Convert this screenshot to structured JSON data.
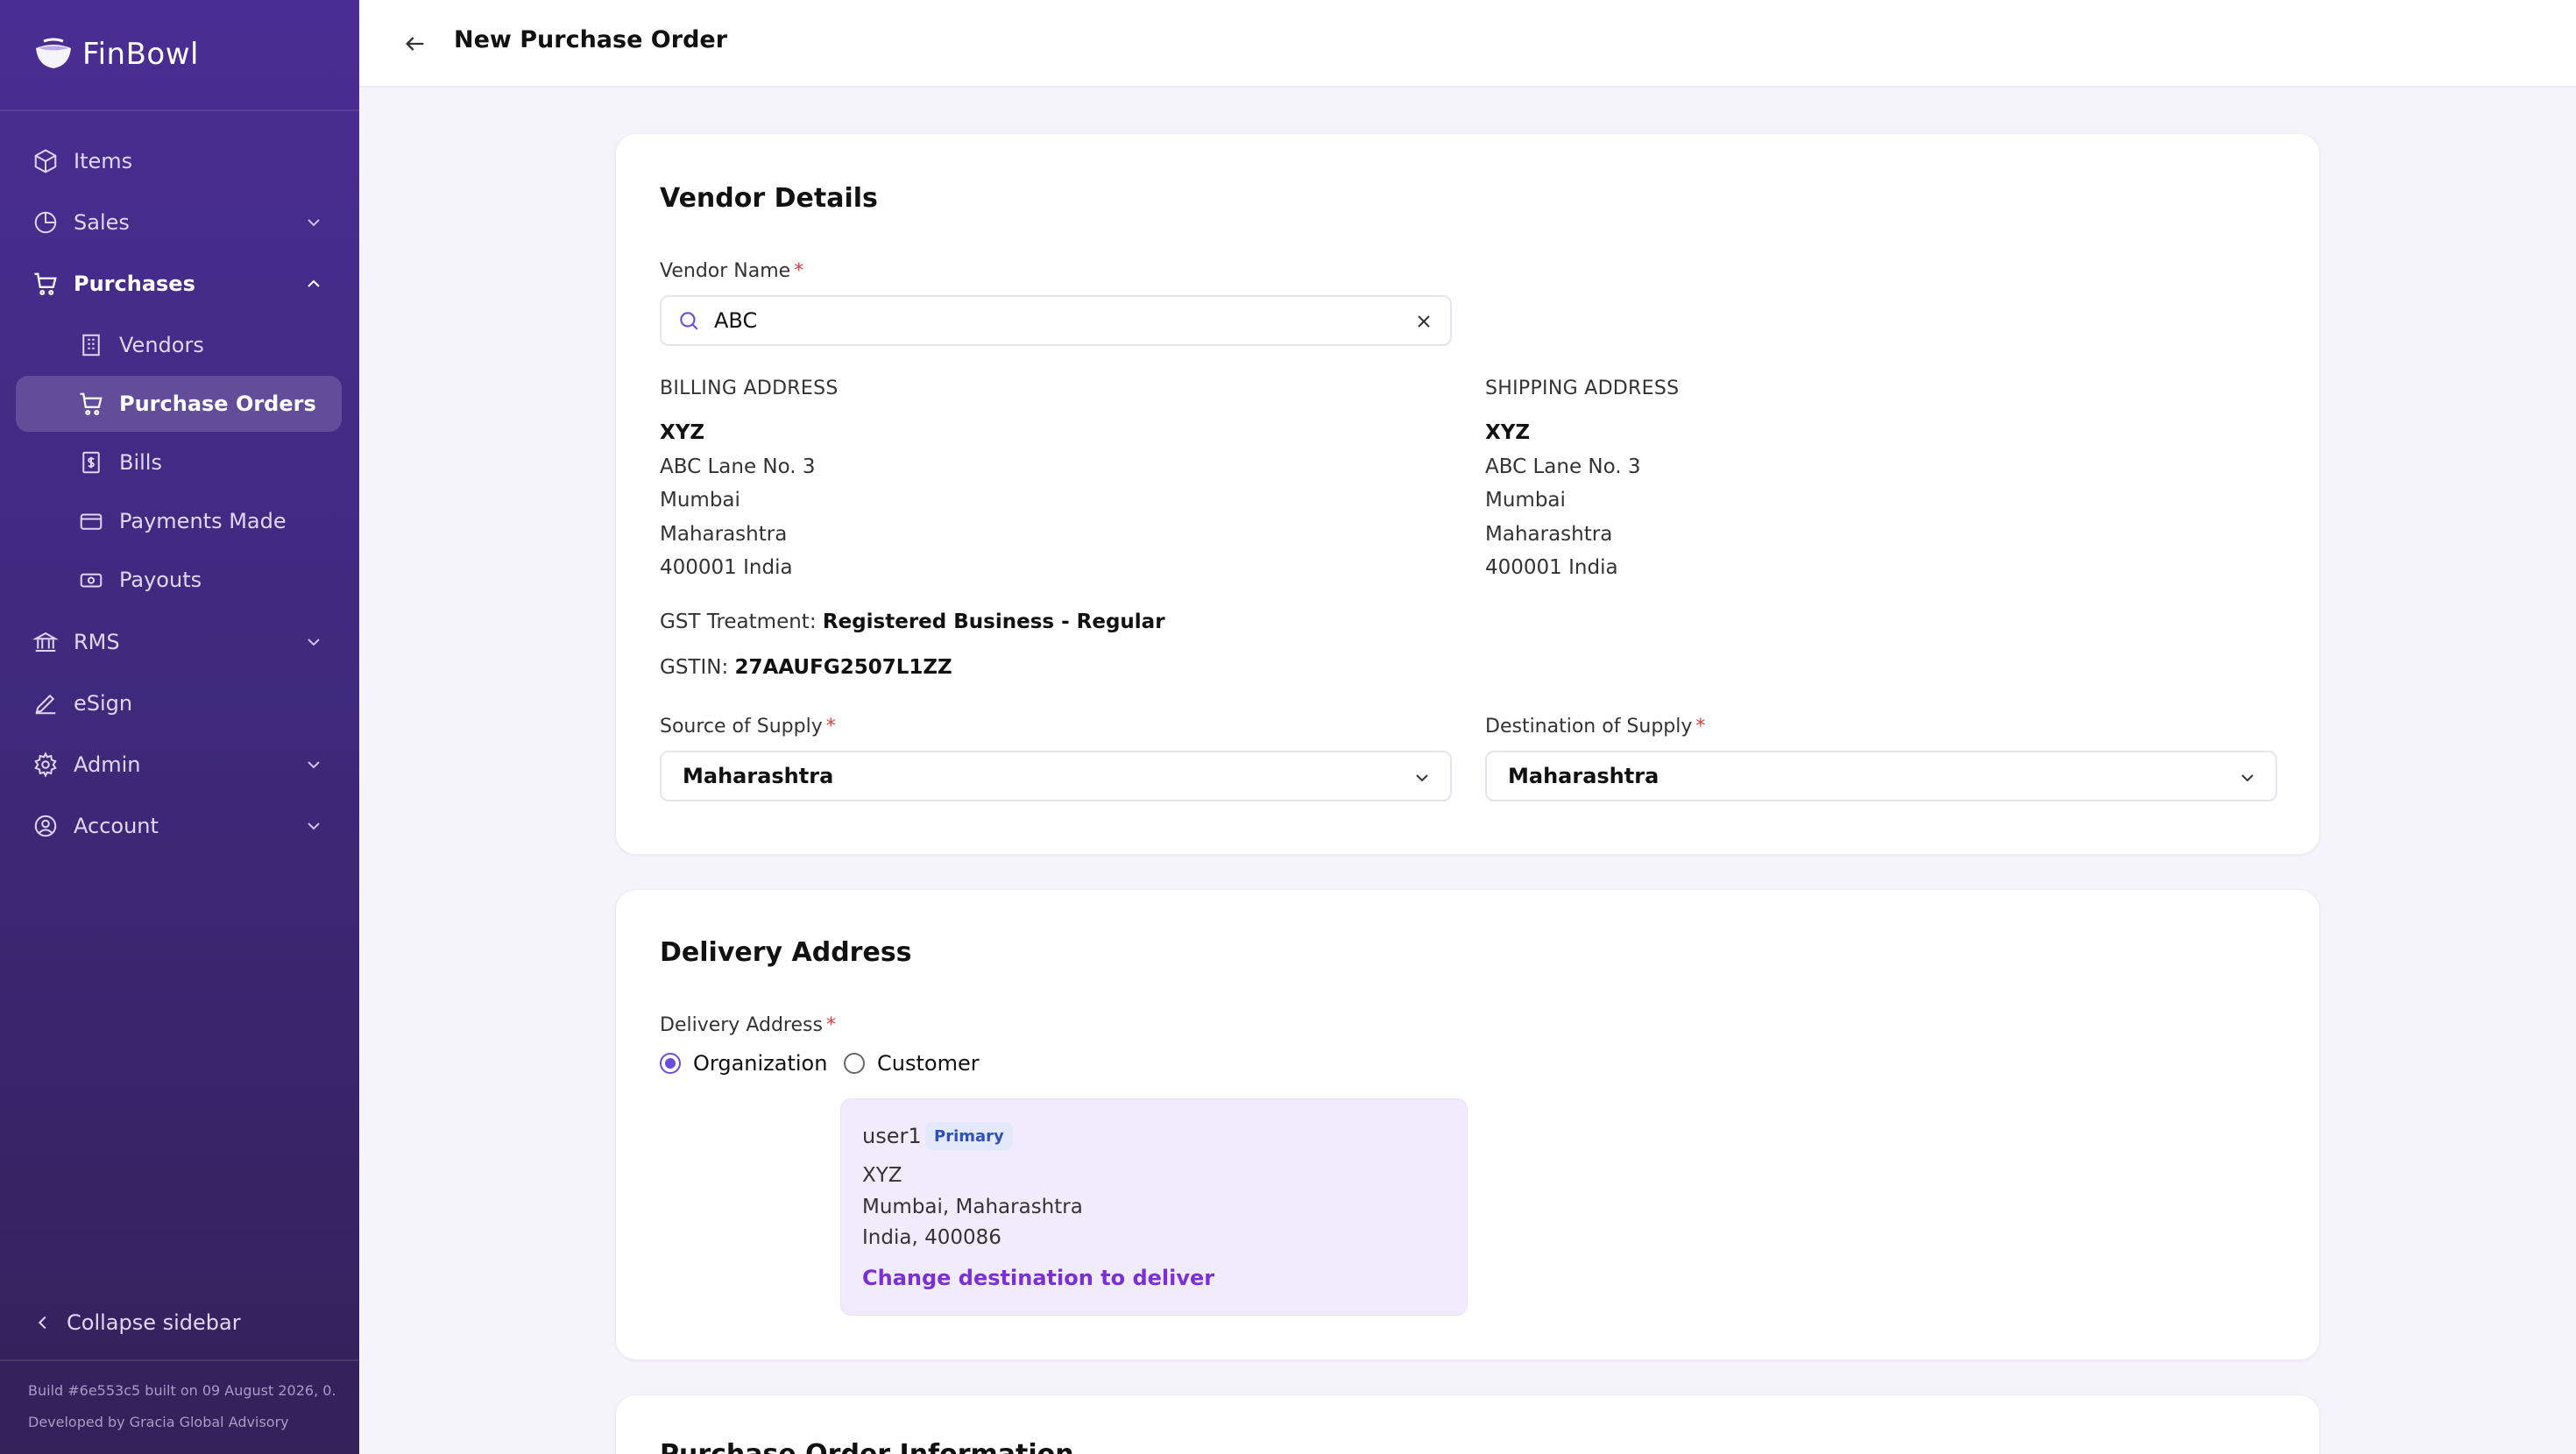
{
  "brand": {
    "name": "FinBowl"
  },
  "sidebar": {
    "items": [
      {
        "label": "Items",
        "icon": "cube-icon"
      },
      {
        "label": "Sales",
        "icon": "pie-chart-icon"
      },
      {
        "label": "Purchases",
        "icon": "cart-icon"
      },
      {
        "label": "Vendors",
        "icon": "building-icon"
      },
      {
        "label": "Purchase Orders",
        "icon": "cart-icon"
      },
      {
        "label": "Bills",
        "icon": "bill-icon"
      },
      {
        "label": "Payments Made",
        "icon": "card-icon"
      },
      {
        "label": "Payouts",
        "icon": "cash-icon"
      },
      {
        "label": "RMS",
        "icon": "bank-icon"
      },
      {
        "label": "eSign",
        "icon": "pen-icon"
      },
      {
        "label": "Admin",
        "icon": "gear-icon"
      },
      {
        "label": "Account",
        "icon": "user-circle-icon"
      }
    ],
    "collapse_label": "Collapse sidebar",
    "build_text": "Build #6e553c5 built on 09 August 2026, 0...",
    "developer_text": "Developed by Gracia Global Advisory"
  },
  "header": {
    "title": "New Purchase Order"
  },
  "vendor": {
    "title": "Vendor Details",
    "vendor_name_label": "Vendor Name",
    "required_mark": "*",
    "vendor_name_value": "ABC",
    "billing": {
      "heading": "BILLING ADDRESS",
      "lines": [
        "XYZ",
        "ABC Lane No. 3",
        "Mumbai",
        "Maharashtra",
        "400001 India"
      ]
    },
    "shipping": {
      "heading": "SHIPPING ADDRESS",
      "lines": [
        "XYZ",
        "ABC Lane No. 3",
        "Mumbai",
        "Maharashtra",
        "400001 India"
      ]
    },
    "gst_treatment_label": "GST Treatment:",
    "gst_treatment_value": "Registered Business - Regular",
    "gstin_label": "GSTIN:",
    "gstin_value": "27AAUFG2507L1ZZ",
    "source_label": "Source of Supply",
    "source_value": "Maharashtra",
    "destination_label": "Destination of Supply",
    "destination_value": "Maharashtra"
  },
  "delivery": {
    "title": "Delivery Address",
    "label": "Delivery Address",
    "options": [
      "Organization",
      "Customer"
    ],
    "selected": "Organization",
    "user": "user1",
    "badge": "Primary",
    "lines": [
      "XYZ",
      "Mumbai, Maharashtra",
      "India, 400086"
    ],
    "change_link": "Change destination to deliver"
  },
  "po_info": {
    "title": "Purchase Order Information"
  },
  "colors": {
    "accent": "#6b4fd8",
    "link": "#7a30d6",
    "sidebar": "#4a2d92",
    "required": "#e03a3a"
  }
}
